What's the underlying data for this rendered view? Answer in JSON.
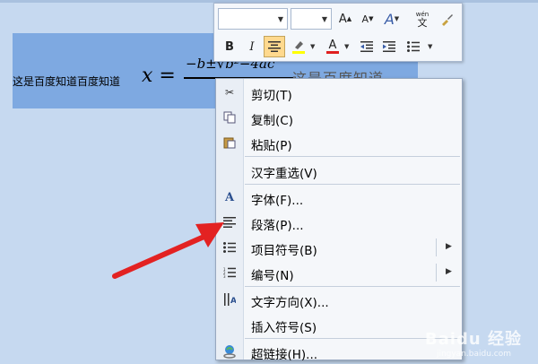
{
  "document": {
    "body_text": "这是百度知道百度知道",
    "formula_lhs": "x =",
    "formula_numerator": "−b±√b²−4ac",
    "tail_text": "这是百度知道"
  },
  "minibar": {
    "font_name": "",
    "font_size": "",
    "buttons": {
      "grow": "A",
      "shrink": "A",
      "style": "A",
      "phonetic_top": "wén",
      "phonetic_bottom": "文",
      "bold": "B",
      "italic": "I",
      "font_color": "A"
    },
    "colors": {
      "highlight": "#ffff00",
      "font_color": "#e02020",
      "active": "#ffd98e"
    }
  },
  "menu": {
    "items": [
      {
        "label": "剪切(T)",
        "icon": "scissors-icon"
      },
      {
        "label": "复制(C)",
        "icon": "copy-icon"
      },
      {
        "label": "粘贴(P)",
        "icon": "paste-icon"
      },
      {
        "label": "汉字重选(V)",
        "icon": ""
      },
      {
        "label": "字体(F)...",
        "icon": "font-icon"
      },
      {
        "label": "段落(P)...",
        "icon": "paragraph-icon"
      },
      {
        "label": "项目符号(B)",
        "icon": "bullets-icon"
      },
      {
        "label": "编号(N)",
        "icon": "numbering-icon"
      },
      {
        "label": "文字方向(X)...",
        "icon": "text-direction-icon"
      },
      {
        "label": "插入符号(S)",
        "icon": ""
      },
      {
        "label": "超链接(H)...",
        "icon": "hyperlink-icon"
      }
    ]
  },
  "watermark": {
    "text": "Baidu 经验",
    "sub": "jingyan.baidu.com"
  },
  "colors": {
    "arrow": "#e32222",
    "selection": "#7ea9e1"
  }
}
